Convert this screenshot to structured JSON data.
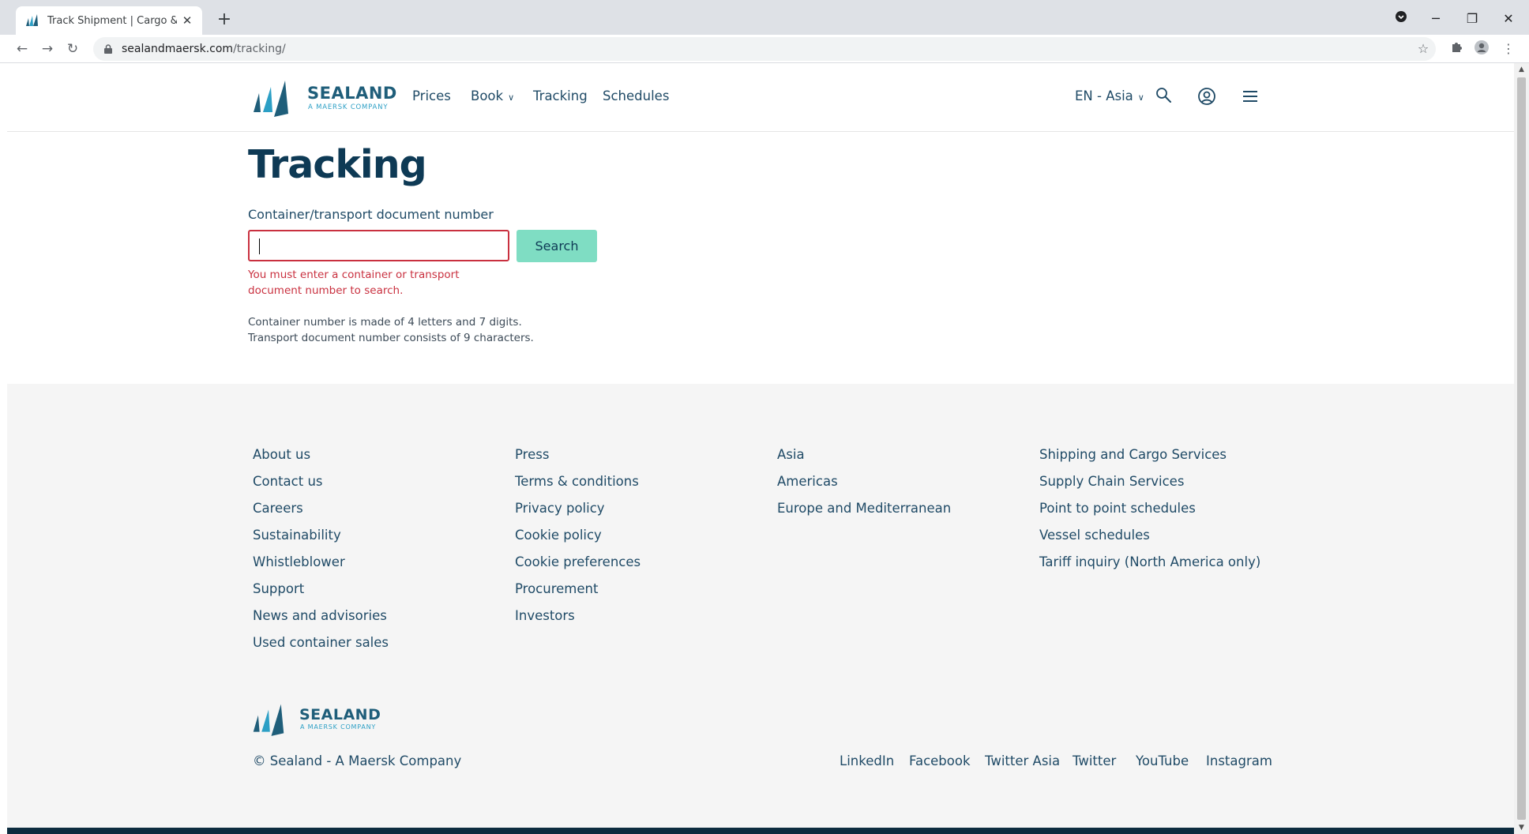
{
  "browser": {
    "tab_title": "Track Shipment | Cargo & Cont",
    "url_host": "sealandmaersk.com",
    "url_path": "/tracking/"
  },
  "header": {
    "logo_word": "SEALAND",
    "logo_sub": "A MAERSK COMPANY",
    "nav": [
      "Prices",
      "Book",
      "Tracking",
      "Schedules"
    ],
    "locale": "EN - Asia"
  },
  "main": {
    "title": "Tracking",
    "field_label": "Container/transport document number",
    "input_value": "",
    "search_label": "Search",
    "error": "You must enter a container or transport document number to search.",
    "hint_line1": "Container number is made of 4 letters and 7 digits.",
    "hint_line2": "Transport document number consists of 9 characters."
  },
  "footer": {
    "col1": [
      "About us",
      "Contact us",
      "Careers",
      "Sustainability",
      "Whistleblower",
      "Support",
      "News and advisories",
      "Used container sales"
    ],
    "col2": [
      "Press",
      "Terms & conditions",
      "Privacy policy",
      "Cookie policy",
      "Cookie preferences",
      "Procurement",
      "Investors"
    ],
    "col3": [
      "Asia",
      "Americas",
      "Europe and Mediterranean"
    ],
    "col4": [
      "Shipping and Cargo Services",
      "Supply Chain Services",
      "Point to point schedules",
      "Vessel schedules",
      "Tariff inquiry (North America only)"
    ],
    "copyright": "© Sealand - A Maersk Company",
    "social": [
      "LinkedIn",
      "Facebook",
      "Twitter Asia",
      "Twitter",
      "YouTube",
      "Instagram"
    ]
  },
  "colors": {
    "brand_navy": "#0e3a55",
    "link": "#1f4a66",
    "button": "#7fddc3",
    "error": "#c9303f",
    "footer_bg": "#f5f5f5"
  }
}
